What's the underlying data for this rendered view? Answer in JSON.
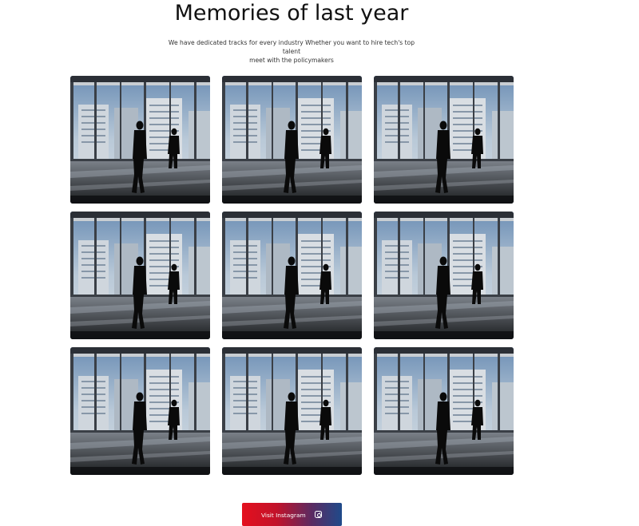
{
  "header": {
    "title": "Memories of last year",
    "subtitle_line1": "We have dedicated tracks for every industry Whether you want to hire tech's top talent",
    "subtitle_line2": "meet with the policymakers"
  },
  "gallery": {
    "photos": [
      {
        "subject": "business-people-silhouette-office-window"
      },
      {
        "subject": "business-people-silhouette-office-window"
      },
      {
        "subject": "business-people-silhouette-office-window"
      },
      {
        "subject": "business-people-silhouette-office-window"
      },
      {
        "subject": "business-people-silhouette-office-window"
      },
      {
        "subject": "business-people-silhouette-office-window"
      },
      {
        "subject": "business-people-silhouette-office-window"
      },
      {
        "subject": "business-people-silhouette-office-window"
      },
      {
        "subject": "business-people-silhouette-office-window"
      }
    ]
  },
  "cta": {
    "label": "Visit Instagram",
    "icon": "instagram-icon",
    "gradient_start": "#e4101e",
    "gradient_end": "#1f4a8a"
  }
}
